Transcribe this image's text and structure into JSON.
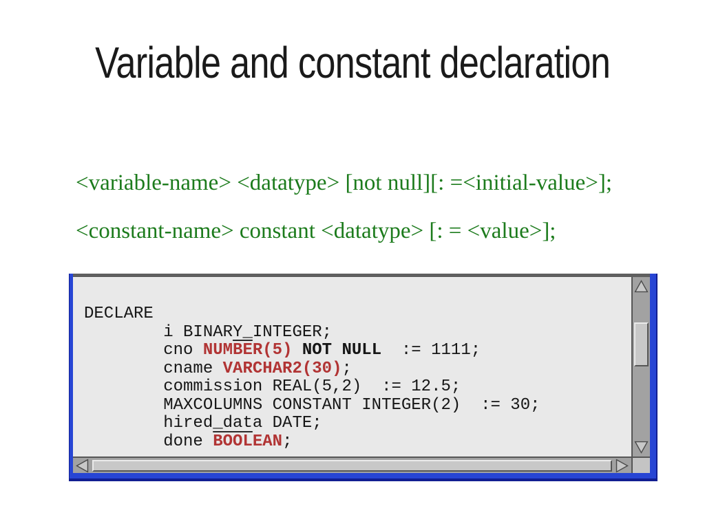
{
  "slide": {
    "title": "Variable and constant declaration",
    "syntax_lines": [
      "<variable-name> <datatype> [not null][: =<initial-value>];",
      "<constant-name> constant <datatype> [: = <value>];"
    ]
  },
  "terminal": {
    "code_lines": [
      {
        "segments": [
          {
            "t": "DECLARE",
            "s": "p"
          }
        ]
      },
      {
        "segments": [
          {
            "t": "        i BINARY_INTEGER;",
            "s": "p"
          }
        ]
      },
      {
        "segments": [
          {
            "t": "        cno ",
            "s": "p"
          },
          {
            "t": "NUM",
            "s": "rb"
          },
          {
            "t": "BE",
            "s": "rbo"
          },
          {
            "t": "R(5)",
            "s": "rb"
          },
          {
            "t": " ",
            "s": "p"
          },
          {
            "t": "NOT NULL",
            "s": "b"
          },
          {
            "t": "  := 1111;",
            "s": "p"
          }
        ]
      },
      {
        "segments": [
          {
            "t": "        cname ",
            "s": "p"
          },
          {
            "t": "VARCHAR2(30)",
            "s": "rb"
          },
          {
            "t": ";",
            "s": "p"
          }
        ]
      },
      {
        "segments": [
          {
            "t": "        commission REAL(5,2)  := 12.5;",
            "s": "p"
          }
        ]
      },
      {
        "segments": [
          {
            "t": "        MAXCOLUMNS CONSTANT INTEGER(2)  := 30;",
            "s": "p"
          }
        ]
      },
      {
        "segments": [
          {
            "t": "        hired_data DATE;",
            "s": "p"
          }
        ]
      },
      {
        "segments": [
          {
            "t": "        done ",
            "s": "p"
          },
          {
            "t": "BOOL",
            "s": "rbo"
          },
          {
            "t": "EAN",
            "s": "rb"
          },
          {
            "t": ";",
            "s": "p"
          }
        ]
      }
    ],
    "icons": {
      "scroll-up-icon": "▲",
      "scroll-down-icon": "▼",
      "scroll-left-icon": "◀",
      "scroll-right-icon": "▶"
    }
  },
  "palette": {
    "frame_blue": "#2745d4",
    "frame_navy": "#111e91",
    "top_gray": "#5f5f5f",
    "content_bg": "#e9e9e9",
    "track_gray": "#a2a2a2",
    "thumb_gray": "#c8c8c8",
    "bevel_light": "#ebebeb",
    "bevel_dark": "#565656",
    "keyword_red": "#b13434",
    "code_black": "#161616",
    "syntax_green": "#1c7b1c",
    "title_color": "#1a1a1a"
  }
}
